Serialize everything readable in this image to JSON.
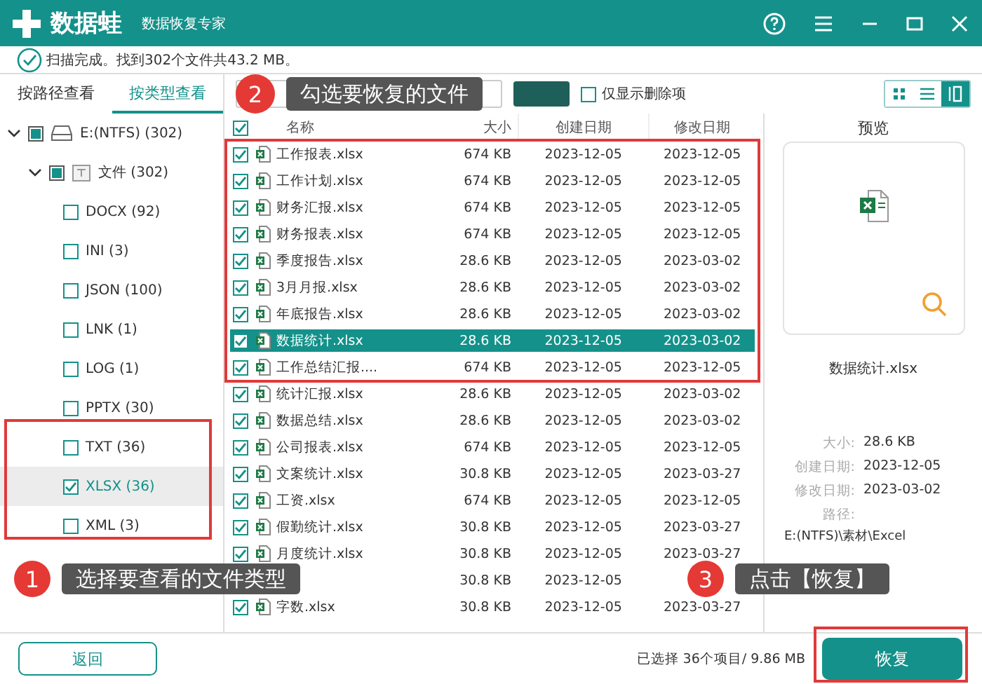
{
  "window": {
    "logo": "数据蛙",
    "subtitle": "数据恢复专家"
  },
  "scan_status": "扫描完成。找到302个文件共43.2 MB。",
  "view_tabs": [
    {
      "label": "按路径查看",
      "selected": false
    },
    {
      "label": "按类型查看",
      "selected": true
    }
  ],
  "tree": [
    {
      "kind": "drive",
      "label": "E:(NTFS) (302)",
      "expanded": true,
      "checked": false,
      "indeterminate": true,
      "selected": false,
      "children": [
        {
          "kind": "folder",
          "label": "文件 (302)",
          "expanded": true,
          "checked": false,
          "indeterminate": true,
          "selected": false,
          "children": [
            {
              "kind": "type",
              "label": "DOCX (92)",
              "checked": false,
              "indeterminate": false,
              "selected": false
            },
            {
              "kind": "type",
              "label": "INI (3)",
              "checked": false,
              "indeterminate": false,
              "selected": false
            },
            {
              "kind": "type",
              "label": "JSON (100)",
              "checked": false,
              "indeterminate": false,
              "selected": false
            },
            {
              "kind": "type",
              "label": "LNK (1)",
              "checked": false,
              "indeterminate": false,
              "selected": false
            },
            {
              "kind": "type",
              "label": "LOG (1)",
              "checked": false,
              "indeterminate": false,
              "selected": false
            },
            {
              "kind": "type",
              "label": "PPTX (30)",
              "checked": false,
              "indeterminate": false,
              "selected": false
            },
            {
              "kind": "type",
              "label": "TXT (36)",
              "checked": false,
              "indeterminate": false,
              "selected": false
            },
            {
              "kind": "type",
              "label": "XLSX (36)",
              "checked": true,
              "indeterminate": false,
              "selected": true
            },
            {
              "kind": "type",
              "label": "XML (3)",
              "checked": false,
              "indeterminate": false,
              "selected": false
            }
          ]
        }
      ]
    }
  ],
  "toolbar": {
    "deleted_only": {
      "label": "仅显示删除项",
      "checked": false
    },
    "view_modes": [
      {
        "kind": "grid",
        "selected": false
      },
      {
        "kind": "list",
        "selected": false
      },
      {
        "kind": "detail",
        "selected": true
      }
    ]
  },
  "table": {
    "all_checked": true,
    "columns": [
      "名称",
      "大小",
      "创建日期",
      "修改日期"
    ],
    "rows": [
      {
        "name": "工作报表.xlsx",
        "size": "674 KB",
        "created": "2023-12-05",
        "modified": "2023-12-05",
        "checked": true,
        "selected": false
      },
      {
        "name": "工作计划.xlsx",
        "size": "674 KB",
        "created": "2023-12-05",
        "modified": "2023-12-05",
        "checked": true,
        "selected": false
      },
      {
        "name": "财务汇报.xlsx",
        "size": "674 KB",
        "created": "2023-12-05",
        "modified": "2023-12-05",
        "checked": true,
        "selected": false
      },
      {
        "name": "财务报表.xlsx",
        "size": "674 KB",
        "created": "2023-12-05",
        "modified": "2023-12-05",
        "checked": true,
        "selected": false
      },
      {
        "name": "季度报告.xlsx",
        "size": "28.6 KB",
        "created": "2023-12-05",
        "modified": "2023-03-02",
        "checked": true,
        "selected": false
      },
      {
        "name": "3月月报.xlsx",
        "size": "28.6 KB",
        "created": "2023-12-05",
        "modified": "2023-03-02",
        "checked": true,
        "selected": false
      },
      {
        "name": "年底报告.xlsx",
        "size": "28.6 KB",
        "created": "2023-12-05",
        "modified": "2023-03-02",
        "checked": true,
        "selected": false
      },
      {
        "name": "数据统计.xlsx",
        "size": "28.6 KB",
        "created": "2023-12-05",
        "modified": "2023-03-02",
        "checked": true,
        "selected": true
      },
      {
        "name": "工作总结汇报....",
        "size": "674 KB",
        "created": "2023-12-05",
        "modified": "2023-12-05",
        "checked": true,
        "selected": false
      },
      {
        "name": "统计汇报.xlsx",
        "size": "28.6 KB",
        "created": "2023-12-05",
        "modified": "2023-03-02",
        "checked": true,
        "selected": false
      },
      {
        "name": "数据总结.xlsx",
        "size": "28.6 KB",
        "created": "2023-12-05",
        "modified": "2023-03-02",
        "checked": true,
        "selected": false
      },
      {
        "name": "公司报表.xlsx",
        "size": "674 KB",
        "created": "2023-12-05",
        "modified": "2023-12-05",
        "checked": true,
        "selected": false
      },
      {
        "name": "文案统计.xlsx",
        "size": "30.8 KB",
        "created": "2023-12-05",
        "modified": "2023-03-27",
        "checked": true,
        "selected": false
      },
      {
        "name": "工资.xlsx",
        "size": "674 KB",
        "created": "2023-12-05",
        "modified": "2023-12-05",
        "checked": true,
        "selected": false
      },
      {
        "name": "假勤统计.xlsx",
        "size": "30.8 KB",
        "created": "2023-12-05",
        "modified": "2023-03-27",
        "checked": true,
        "selected": false
      },
      {
        "name": "月度统计.xlsx",
        "size": "30.8 KB",
        "created": "2023-12-05",
        "modified": "2023-03-27",
        "checked": true,
        "selected": false
      },
      {
        "size": "30.8 KB",
        "created": "2023-12-05",
        "selected": false
      },
      {
        "name": "字数.xlsx",
        "size": "30.8 KB",
        "created": "2023-12-05",
        "modified": "2023-03-27",
        "checked": true,
        "selected": false
      }
    ]
  },
  "preview": {
    "title": "预览",
    "file_name": "数据统计.xlsx",
    "details": [
      {
        "label": "大小:",
        "value": "28.6 KB"
      },
      {
        "label": "创建日期:",
        "value": "2023-12-05"
      },
      {
        "label": "修改日期:",
        "value": "2023-03-02"
      }
    ],
    "path_label": "路径:",
    "path": "E:(NTFS)\\素材\\Excel"
  },
  "footer": {
    "back": "返回",
    "selection": "已选择 36个项目/ 9.86 MB",
    "recover": "恢复"
  },
  "callouts": [
    {
      "number": "1",
      "text": "选择要查看的文件类型"
    },
    {
      "number": "2",
      "text": "勾选要恢复的文件"
    },
    {
      "number": "3",
      "text": "点击【恢复】"
    }
  ]
}
